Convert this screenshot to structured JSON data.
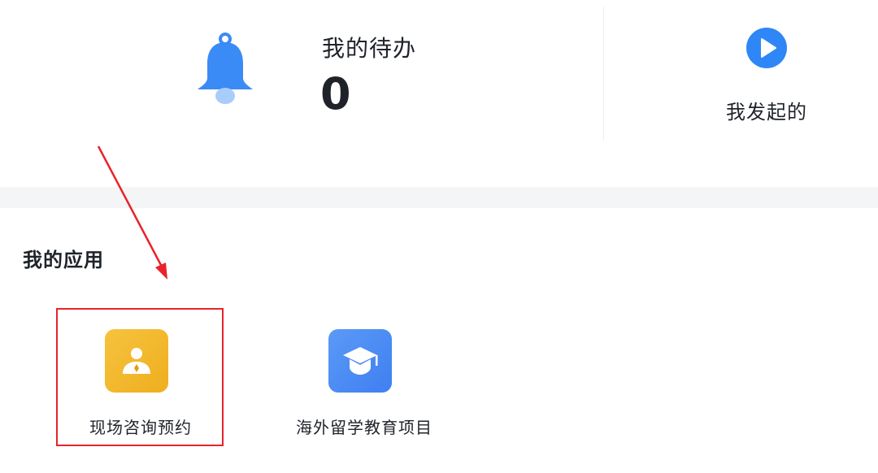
{
  "todo": {
    "label": "我的待办",
    "count": "0"
  },
  "started": {
    "label": "我发起的"
  },
  "apps": {
    "title": "我的应用",
    "items": [
      {
        "label": "现场咨询预约",
        "icon": "consultant-icon",
        "color": "#f2b52c"
      },
      {
        "label": "海外留学教育项目",
        "icon": "graduation-cap-icon",
        "color": "#4a89f4"
      }
    ]
  },
  "colors": {
    "primary_blue": "#3a8bf5",
    "annotation_red": "#e8232a",
    "band_grey": "#f4f5f7"
  }
}
